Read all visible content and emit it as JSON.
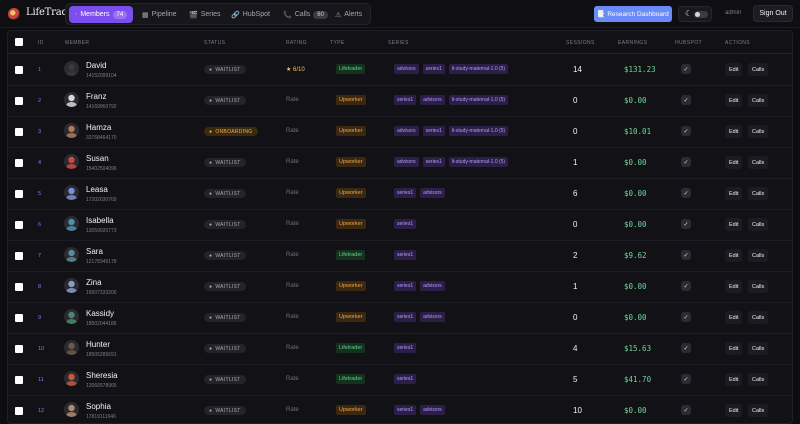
{
  "app": {
    "title": "LifeTrade"
  },
  "nav": [
    {
      "icon": "·",
      "label": "Members",
      "count": "74",
      "active": true
    },
    {
      "icon": "▦",
      "label": "Pipeline"
    },
    {
      "icon": "🎬",
      "label": "Series"
    },
    {
      "icon": "🔗",
      "label": "HubSpot"
    },
    {
      "icon": "📞",
      "label": "Calls",
      "count": "60"
    },
    {
      "icon": "⚠",
      "label": "Alerts"
    }
  ],
  "header": {
    "research_label": "Research Dashboard",
    "research_icon": "📑",
    "theme_icon": "☾",
    "admin_label": "admin",
    "signout_label": "Sign Out"
  },
  "table": {
    "columns": {
      "id": "ID",
      "member": "MEMBER",
      "status": "STATUS",
      "rating": "RATING",
      "type": "TYPE",
      "series": "SERIES",
      "sessions": "SESSIONS",
      "earnings": "EARNINGS",
      "hubspot": "HUBSPOT",
      "actions": "ACTIONS"
    },
    "action_labels": {
      "edit": "Edit",
      "calls": "Calls"
    },
    "rows": [
      {
        "id": "1",
        "name": "David",
        "phone": "14152099104",
        "status": "WAITLIST",
        "rating": "★ 6/10",
        "rating_set": true,
        "type": "Lifetrader",
        "series": [
          "advisors",
          "series1",
          "lt-study-maternal-1.0 (5)"
        ],
        "sessions": "14",
        "earnings": "$131.23",
        "hubspot": "✓",
        "avatar_color": "#3a3a3a"
      },
      {
        "id": "2",
        "name": "Franz",
        "phone": "14169960792",
        "status": "WAITLIST",
        "rating": "Rate",
        "rating_set": false,
        "type": "Upworker",
        "series": [
          "series1",
          "advisors",
          "lt-study-maternal-1.0 (5)"
        ],
        "sessions": "0",
        "earnings": "$0.00",
        "hubspot": "✓",
        "avatar_color": "#d8d8d8"
      },
      {
        "id": "3",
        "name": "Hamza",
        "phone": "33768464170",
        "status": "ONBOARDING",
        "rating": "Rate",
        "rating_set": false,
        "type": "Upworker",
        "series": [
          "advisors",
          "series1",
          "lt-study-maternal-1.0 (5)"
        ],
        "sessions": "0",
        "earnings": "$10.01",
        "hubspot": "✓",
        "avatar_color": "#b07a58"
      },
      {
        "id": "4",
        "name": "Susan",
        "phone": "15402504096",
        "status": "WAITLIST",
        "rating": "Rate",
        "rating_set": false,
        "type": "Upworker",
        "series": [
          "advisors",
          "series1",
          "lt-study-maternal-1.0 (5)"
        ],
        "sessions": "1",
        "earnings": "$0.00",
        "hubspot": "✓",
        "avatar_color": "#c94a4a"
      },
      {
        "id": "5",
        "name": "Leasa",
        "phone": "17202030769",
        "status": "WAITLIST",
        "rating": "Rate",
        "rating_set": false,
        "type": "Upworker",
        "series": [
          "series1",
          "advisors"
        ],
        "sessions": "6",
        "earnings": "$0.00",
        "hubspot": "✓",
        "avatar_color": "#7d8fd6"
      },
      {
        "id": "6",
        "name": "Isabella",
        "phone": "13059920773",
        "status": "WAITLIST",
        "rating": "Rate",
        "rating_set": false,
        "type": "Upworker",
        "series": [
          "series1"
        ],
        "sessions": "0",
        "earnings": "$0.00",
        "hubspot": "✓",
        "avatar_color": "#4f8fb0"
      },
      {
        "id": "7",
        "name": "Sara",
        "phone": "12178349178",
        "status": "WAITLIST",
        "rating": "Rate",
        "rating_set": false,
        "type": "Lifetrader",
        "series": [
          "series1"
        ],
        "sessions": "2",
        "earnings": "$9.62",
        "hubspot": "✓",
        "avatar_color": "#5a8a9a"
      },
      {
        "id": "8",
        "name": "Zina",
        "phone": "16507333206",
        "status": "WAITLIST",
        "rating": "Rate",
        "rating_set": false,
        "type": "Upworker",
        "series": [
          "series1",
          "advisors"
        ],
        "sessions": "1",
        "earnings": "$0.00",
        "hubspot": "✓",
        "avatar_color": "#8d9ac8"
      },
      {
        "id": "9",
        "name": "Kassidy",
        "phone": "18502044186",
        "status": "WAITLIST",
        "rating": "Rate",
        "rating_set": false,
        "type": "Upworker",
        "series": [
          "series1",
          "advisors"
        ],
        "sessions": "0",
        "earnings": "$0.00",
        "hubspot": "✓",
        "avatar_color": "#4a8a6a"
      },
      {
        "id": "10",
        "name": "Hunter",
        "phone": "18505285691",
        "status": "WAITLIST",
        "rating": "Rate",
        "rating_set": false,
        "type": "Lifetrader",
        "series": [
          "series1"
        ],
        "sessions": "4",
        "earnings": "$15.63",
        "hubspot": "✓",
        "avatar_color": "#6a5a4a"
      },
      {
        "id": "11",
        "name": "Sheresia",
        "phone": "12066578965",
        "status": "WAITLIST",
        "rating": "Rate",
        "rating_set": false,
        "type": "Lifetrader",
        "series": [
          "series1"
        ],
        "sessions": "5",
        "earnings": "$41.70",
        "hubspot": "✓",
        "avatar_color": "#c45a3a"
      },
      {
        "id": "12",
        "name": "Sophia",
        "phone": "17819111946",
        "status": "WAITLIST",
        "rating": "Rate",
        "rating_set": false,
        "type": "Upworker",
        "series": [
          "series1",
          "advisors"
        ],
        "sessions": "10",
        "earnings": "$0.00",
        "hubspot": "✓",
        "avatar_color": "#b08a6a"
      }
    ]
  }
}
